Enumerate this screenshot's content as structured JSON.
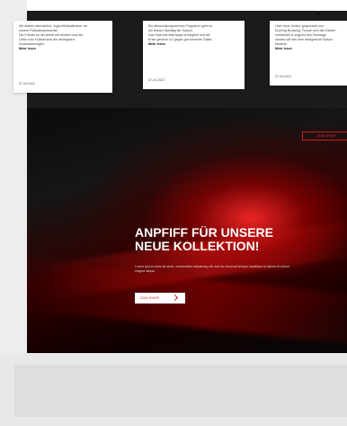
{
  "cards": [
    {
      "lines": [
        "Wir starten demnächst, Jugendfußballtrainer für",
        "unsere Fußballmannschaft.",
        "Die Freude an der Arbeit mit Kindern und der",
        "Liebe zum Fußball sind die wichtigsten",
        "Voraussetzungen."
      ],
      "more": "Mehr lesen",
      "date": "07.04.2022"
    },
    {
      "lines": [
        "Ein abwechslungsreiches Programm geht es",
        "am letzten Spieltag der Saison.",
        "Das Spiel hat überhaupt ermöglicht und die",
        "Erste gewinnt 4:2 gegen gut formierte Gäste."
      ],
      "more": "Mehr lesen",
      "date": "07.04.2022"
    },
    {
      "lines": [
        "Über neue Zeiten: gesponsert von",
        "Euching Brucking. Freuen sich die Kleinen",
        "vorbereitet & zugunst des Sonntags",
        "werden wir hier eine erfolgreiche Saison",
        "bestens."
      ],
      "more": "Mehr lesen",
      "date": "07.04.2022"
    }
  ],
  "top_button": "ZUM SHOP",
  "hero": {
    "headline_line1": "ANPFIFF FÜR UNSERE",
    "headline_line2": "NEUE KOLLEKTION!",
    "subtitle": "Lorem ipsum dolor sit amet, consectetur adipiscing elit, sed do eiusmod tempor incididunt ut labore et dolore magna aliqua.",
    "cta_label": "ZUM SHOP",
    "cta_icon": "arrow-icon"
  },
  "colors": {
    "accent_red": "#c81e1e",
    "hero_dark": "#121212"
  }
}
